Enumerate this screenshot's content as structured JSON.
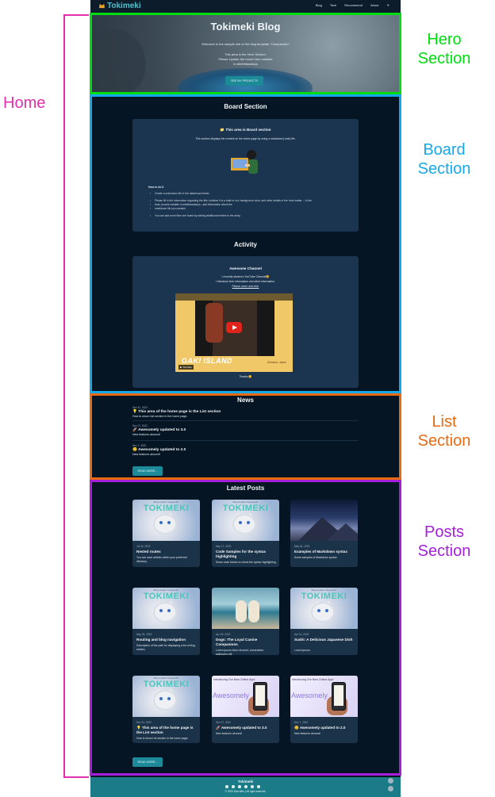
{
  "nav": {
    "logo": "Tokimeki",
    "links": [
      "Blog",
      "Tech",
      "Recommend",
      "About",
      "☀"
    ]
  },
  "hero": {
    "title": "Tokimeki Blog",
    "subtitle": "Welcome to the sample site of the blog template \"Campanula\"!",
    "line2": "This area is the Hero Section.",
    "line3": "Please Update the home.hero variable",
    "line4": "in siteMetadata.js",
    "button": "SEE MY PROJECTS"
  },
  "board": {
    "title": "Board Section",
    "card_title": "📁 This area is Board section",
    "card_desc": "This section displays the content on the home page by using a markdown(.mdx) file.",
    "how_title": "How to do it",
    "bullets": [
      "Create a markdown file in the  data/board  folder.",
      "Please fill in the information regarding the title, whether it is a draft or not, background color, and other details in the front matter -- In the",
      "  boar_boards  variable of  siteMetadata.js , add information about the",
      "  markdown file you created.",
      "You can add more files one board by adding additional entries to the array."
    ]
  },
  "activity": {
    "title": "Activity",
    "card_title": "Awesome Channel",
    "line1": "I recently started a YouTube Channel😄",
    "line2": "I introduce tech information and other information.",
    "line3": "Please come and visit.",
    "video_text": "GAKI ISLAND",
    "video_sub": "Okinawa, Japan",
    "yt_label": "▶ YouTube",
    "footer_text": "Thanks 🙂"
  },
  "news": {
    "title": "News",
    "items": [
      {
        "date": "Dec 31, 2022",
        "title": "💡 This area of the home page is the List section",
        "desc": "How to show List section in the home page."
      },
      {
        "date": "Dec 27, 2022",
        "title": "🚀 Awesomely updated to 3.0",
        "desc": "New features abound!"
      },
      {
        "date": "Dec 7, 2022",
        "title": "😊 Awesomely updated to 2.0",
        "desc": "New features abound!"
      }
    ],
    "read_more": "READ MORE..."
  },
  "posts": {
    "title": "Latest Posts",
    "items": [
      {
        "thumb": "cat",
        "date": "Jul 04, 2023",
        "title": "Nested routes",
        "desc": "You can save articles within your preferred directory."
      },
      {
        "thumb": "cat",
        "date": "May 17, 2023",
        "title": "Code Samples for the syntax highlighting",
        "desc": "Some code blocks to check the syntax highlighting"
      },
      {
        "thumb": "sky",
        "date": "May 04, 2023",
        "title": "Examples of Markdown syntax",
        "desc": "Some samples of Markdown syntax."
      },
      {
        "thumb": "cat",
        "date": "May 04, 2023",
        "title": "Routing and blog navigation",
        "desc": "Description of the path for displaying a list of blog articles"
      },
      {
        "thumb": "dog",
        "date": "Apr 25, 2023",
        "title": "Dogs: The Loyal Canine Companions",
        "desc": "Lorem ipsum dolor sit amet, consectetur adipiscing elit."
      },
      {
        "thumb": "cat",
        "date": "Apr 10, 2023",
        "title": "Sushi: A Delicious Japanese Dish",
        "desc": "Lorem ipsum."
      },
      {
        "thumb": "cat",
        "date": "Dec 31, 2022",
        "title": "💡 This area of the home page is the List section",
        "desc": "How to show List section in the home page."
      },
      {
        "thumb": "phone",
        "date": "Dec 27, 2022",
        "title": "🚀 Awesomely updated to 3.0",
        "desc": "New features abound!"
      },
      {
        "thumb": "phone",
        "date": "Dec 7, 2022",
        "title": "😊 Awesomely updated to 2.0",
        "desc": "New features abound!"
      }
    ],
    "thumb_brand": "TOKIMEKI",
    "thumb_brandsub": "Blog template \"Campanula\"",
    "thumb_intro": "Introducing Our New Online App!",
    "thumb_awesome": "Awesomely",
    "read_more": "READ MORE..."
  },
  "footer": {
    "title": "Tokimeki",
    "copyright": "© 2023 Dan Wen | All right reserved."
  },
  "annotations": {
    "home": "Home",
    "hero": [
      "Hero",
      "Section"
    ],
    "board": [
      "Board",
      "Section"
    ],
    "list": [
      "List",
      "Section"
    ],
    "posts": [
      "Posts",
      "Section"
    ]
  },
  "colors": {
    "hero": "#00dd10",
    "board": "#16a8e8",
    "list": "#e86a12",
    "posts": "#a51fd8",
    "home": "#e22fae"
  }
}
